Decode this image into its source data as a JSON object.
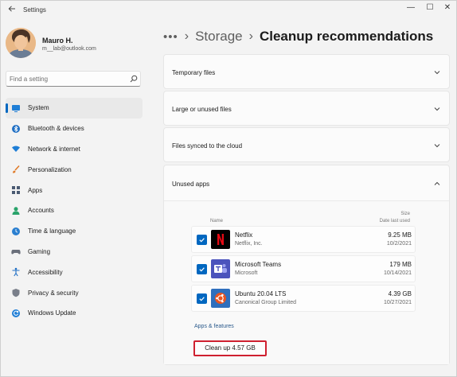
{
  "window": {
    "title": "Settings",
    "back_icon": "arrow-left-icon",
    "controls": {
      "minimize": "—",
      "maximize": "☐",
      "close": "✕"
    }
  },
  "profile": {
    "name": "Mauro H.",
    "email": "m__lab@outlook.com"
  },
  "search": {
    "placeholder": "Find a setting"
  },
  "nav": {
    "items": [
      {
        "label": "System",
        "icon": "monitor-icon",
        "active": true
      },
      {
        "label": "Bluetooth & devices",
        "icon": "bluetooth-icon"
      },
      {
        "label": "Network & internet",
        "icon": "wifi-icon"
      },
      {
        "label": "Personalization",
        "icon": "brush-icon"
      },
      {
        "label": "Apps",
        "icon": "apps-icon"
      },
      {
        "label": "Accounts",
        "icon": "person-icon"
      },
      {
        "label": "Time & language",
        "icon": "globe-clock-icon"
      },
      {
        "label": "Gaming",
        "icon": "gamepad-icon"
      },
      {
        "label": "Accessibility",
        "icon": "accessibility-icon"
      },
      {
        "label": "Privacy & security",
        "icon": "shield-icon"
      },
      {
        "label": "Windows Update",
        "icon": "refresh-icon"
      }
    ]
  },
  "breadcrumb": {
    "more": "•••",
    "sep": "›",
    "parent": "Storage",
    "current": "Cleanup recommendations"
  },
  "sections": [
    {
      "title": "Temporary files",
      "expanded": false
    },
    {
      "title": "Large or unused files",
      "expanded": false
    },
    {
      "title": "Files synced to the cloud",
      "expanded": false
    },
    {
      "title": "Unused apps",
      "expanded": true
    }
  ],
  "unused_apps": {
    "columns": {
      "name": "Name",
      "size": "Size",
      "date": "Date last used"
    },
    "apps": [
      {
        "name": "Netflix",
        "publisher": "Netflix, Inc.",
        "size": "9.25 MB",
        "date": "10/2/2021",
        "checked": true,
        "icon": "netflix-icon",
        "color": "#000000"
      },
      {
        "name": "Microsoft Teams",
        "publisher": "Microsoft",
        "size": "179 MB",
        "date": "10/14/2021",
        "checked": true,
        "icon": "teams-icon",
        "color": "#4b53bc"
      },
      {
        "name": "Ubuntu 20.04 LTS",
        "publisher": "Canonical Group Limited",
        "size": "4.39 GB",
        "date": "10/27/2021",
        "checked": true,
        "icon": "ubuntu-icon",
        "color": "#e95420"
      }
    ],
    "link": "Apps & features",
    "cleanup_button": "Clean up 4.57 GB"
  },
  "colors": {
    "accent": "#0067c0",
    "highlight_border": "#cf2030"
  }
}
